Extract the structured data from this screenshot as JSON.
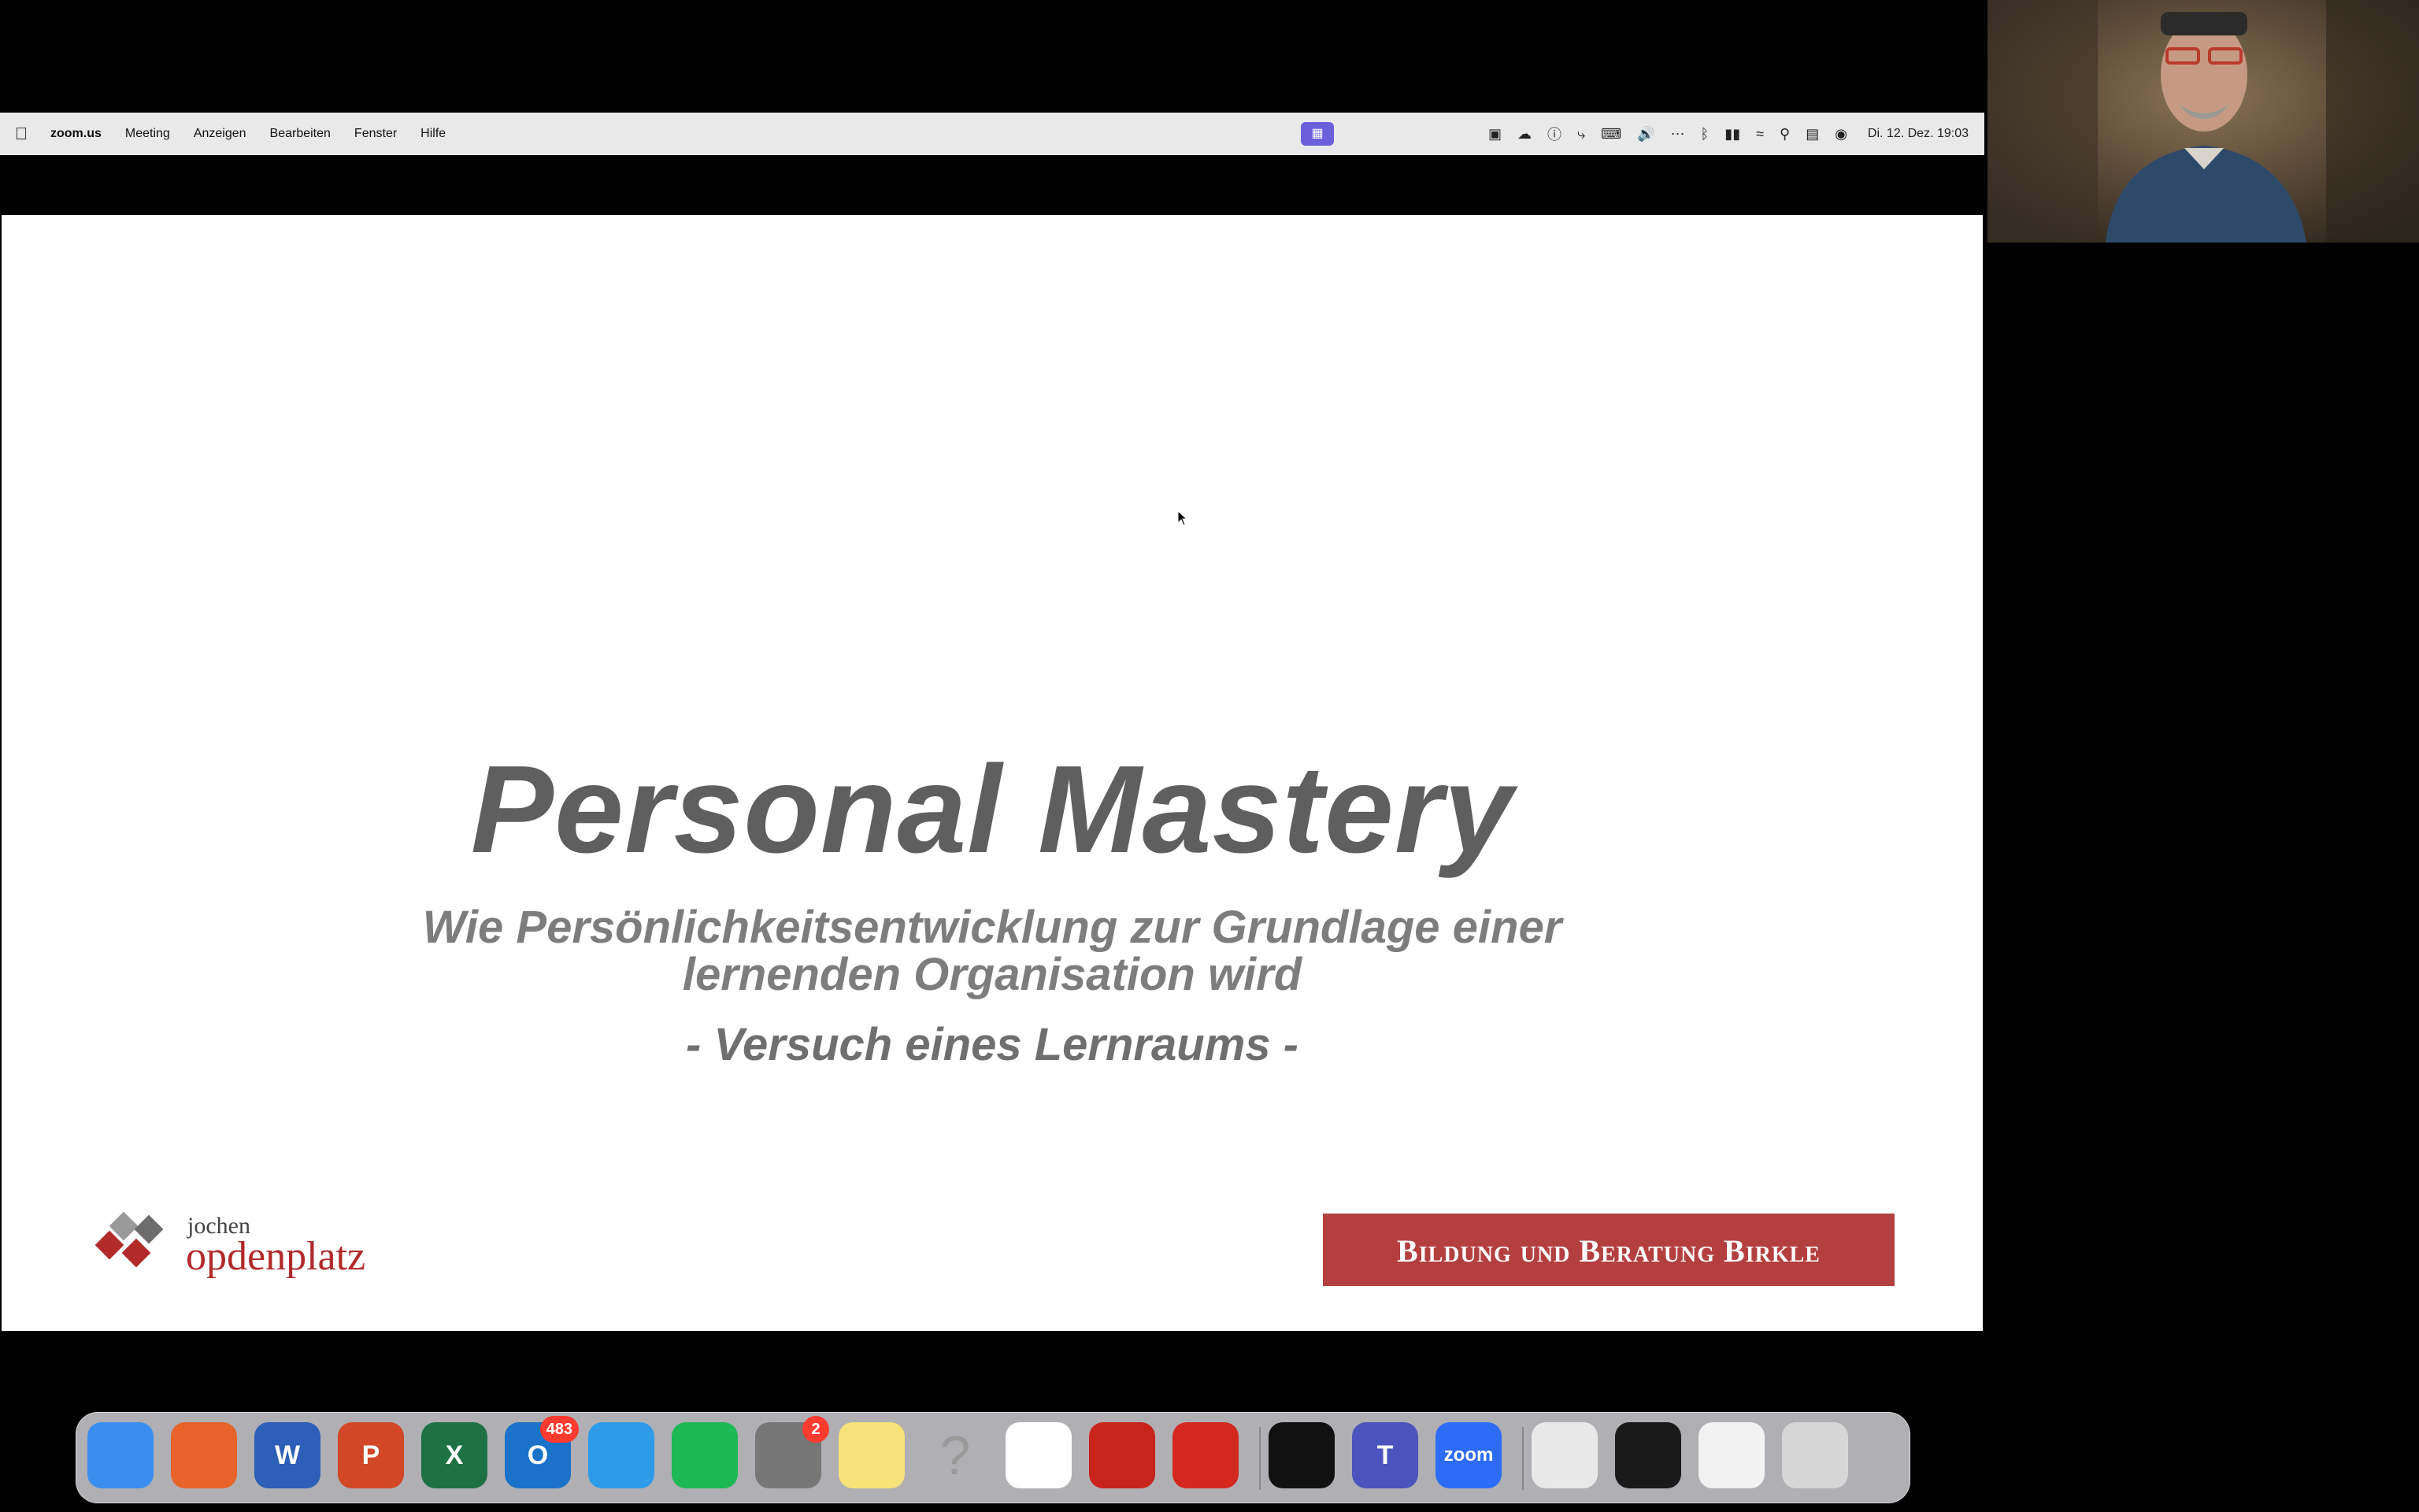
{
  "menubar": {
    "app_name": "zoom.us",
    "items": [
      "Meeting",
      "Anzeigen",
      "Bearbeiten",
      "Fenster",
      "Hilfe"
    ],
    "clock": "Di. 12. Dez. 19:03"
  },
  "slide": {
    "title": "Personal Mastery",
    "subtitle_line1": "Wie Persönlichkeitsentwicklung zur Grundlage einer",
    "subtitle_line2": "lernenden Organisation wird",
    "tagline": "- Versuch eines Lernraums -",
    "logo_first": "jochen",
    "logo_last": "opdenplatz",
    "banner": "Bildung und Beratung Birkle"
  },
  "dock": {
    "apps": [
      {
        "name": "finder-app",
        "icon": "finder-icon",
        "color": "#3a8ef0"
      },
      {
        "name": "firefox-app",
        "icon": "firefox-icon",
        "color": "#e8632a"
      },
      {
        "name": "word-app",
        "icon": "word-icon",
        "color": "#2b5fb8",
        "glyph": "W"
      },
      {
        "name": "powerpoint-app",
        "icon": "powerpoint-icon",
        "color": "#d24726",
        "glyph": "P"
      },
      {
        "name": "excel-app",
        "icon": "excel-icon",
        "color": "#1e7145",
        "glyph": "X"
      },
      {
        "name": "outlook-app",
        "icon": "outlook-icon",
        "color": "#1a73c9",
        "glyph": "O",
        "badge": "483"
      },
      {
        "name": "safari-app",
        "icon": "safari-icon",
        "color": "#2d9be8"
      },
      {
        "name": "spotify-app",
        "icon": "spotify-icon",
        "color": "#1db954"
      },
      {
        "name": "settings-app",
        "icon": "settings-icon",
        "color": "#777",
        "badge": "2"
      },
      {
        "name": "notes-app",
        "icon": "notes-icon",
        "color": "#f7e27a"
      },
      {
        "name": "unknown-app",
        "icon": "question-icon",
        "color": "transparent",
        "glyph": "?"
      },
      {
        "name": "onedrive-app",
        "icon": "onedrive-icon",
        "color": "#ffffff"
      },
      {
        "name": "acrobat-app",
        "icon": "acrobat-icon",
        "color": "#c9241b"
      },
      {
        "name": "avira-app",
        "icon": "avira-icon",
        "color": "#d4281f"
      },
      {
        "name": "clock-app",
        "icon": "clock-icon",
        "color": "#111"
      },
      {
        "name": "teams-app",
        "icon": "teams-icon",
        "color": "#4b53bc",
        "glyph": "T"
      },
      {
        "name": "zoom-app",
        "icon": "zoom-icon",
        "color": "#2d6cf6",
        "glyph": "zoom"
      }
    ]
  },
  "colors": {
    "title": "#5f5f5f",
    "subtitle": "#7d7d7d",
    "banner": "#b3403f",
    "logo_red": "#b22a2a",
    "share_indicator": "#6b5fdc"
  }
}
